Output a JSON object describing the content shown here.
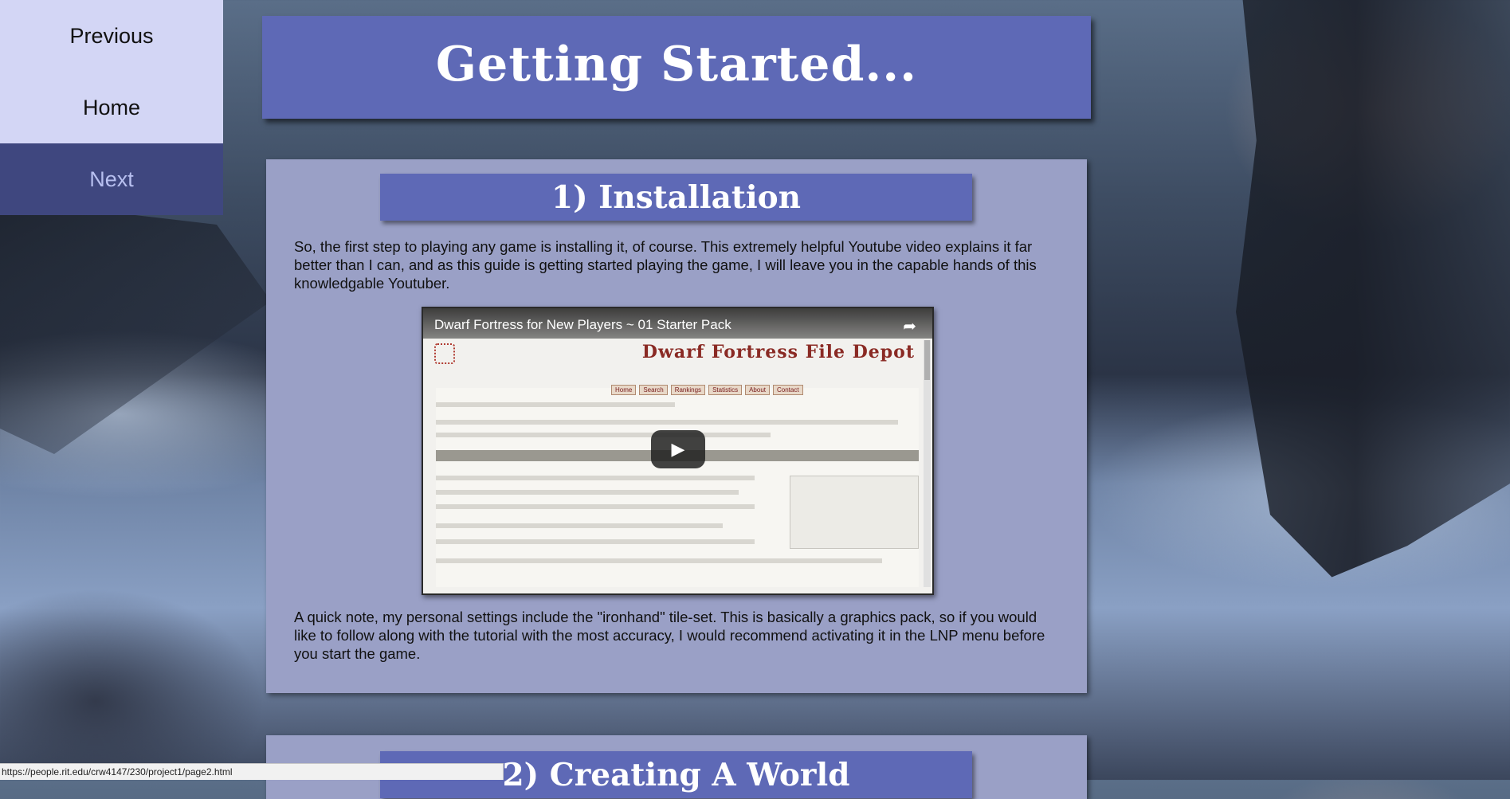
{
  "nav": {
    "previous": "Previous",
    "home": "Home",
    "next": "Next"
  },
  "header": {
    "title": "Getting Started..."
  },
  "sections": [
    {
      "title": "1) Installation",
      "para1": "So, the first step to playing any game is installing it, of course. This extremely helpful Youtube video explains it far better than I can, and as this guide is getting started playing the game, I will leave you in the capable hands of this knowledgable Youtuber.",
      "video": {
        "title": "Dwarf Fortress for New Players ~ 01 Starter Pack",
        "banner": "Dwarf Fortress File Depot",
        "menu": [
          "Home",
          "Search",
          "Rankings",
          "Statistics",
          "About",
          "Contact"
        ]
      },
      "para2": "A quick note, my personal settings include the \"ironhand\" tile-set. This is basically a graphics pack, so if you would like to follow along with the tutorial with the most accuracy, I would recommend activating it in the LNP menu before you start the game."
    },
    {
      "title": "2) Creating A World"
    }
  ],
  "statusbar": {
    "url": "https://people.rit.edu/crw4147/230/project1/page2.html"
  },
  "colors": {
    "nav_bg": "#d3d6f5",
    "nav_active_bg": "#3f477f",
    "header_bg": "#5e69b6",
    "section_bg": "#9aa0c6"
  }
}
